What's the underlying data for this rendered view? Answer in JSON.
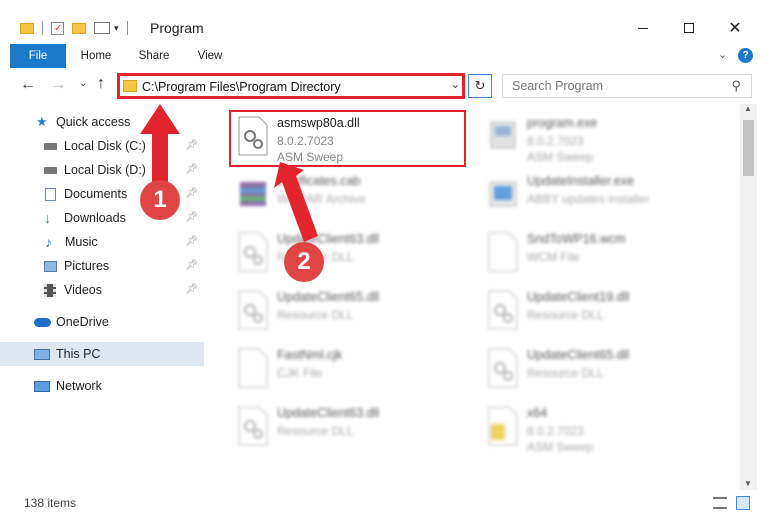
{
  "window": {
    "title": "Program"
  },
  "ribbon": {
    "tabs": [
      "File",
      "Home",
      "Share",
      "View"
    ]
  },
  "address": {
    "path": "C:\\Program Files\\Program Directory"
  },
  "search": {
    "placeholder": "Search Program"
  },
  "sidebar": {
    "items": [
      {
        "label": "Quick access",
        "icon": "star-icon"
      },
      {
        "label": "Local Disk (C:)",
        "icon": "drive-icon"
      },
      {
        "label": "Local Disk (D:)",
        "icon": "drive-icon"
      },
      {
        "label": "Documents",
        "icon": "documents-icon"
      },
      {
        "label": "Downloads",
        "icon": "download-icon"
      },
      {
        "label": "Music",
        "icon": "music-icon"
      },
      {
        "label": "Pictures",
        "icon": "pictures-icon"
      },
      {
        "label": "Videos",
        "icon": "videos-icon"
      },
      {
        "label": "OneDrive",
        "icon": "cloud-icon"
      },
      {
        "label": "This PC",
        "icon": "pc-icon"
      },
      {
        "label": "Network",
        "icon": "network-icon"
      }
    ]
  },
  "files": [
    {
      "name": "asmswp80a.dll",
      "line2": "8.0.2.7023",
      "line3": "ASM Sweep",
      "icon": "dll-gear-icon"
    },
    {
      "name": "program.exe",
      "line2": "8.0.2.7023",
      "line3": "ASM Sweep",
      "icon": "exe-icon"
    },
    {
      "name": "certificates.cab",
      "line2": "WinRAR Archive",
      "line3": "",
      "icon": "archive-icon"
    },
    {
      "name": "UpdateInstaller.exe",
      "line2": "ABBY updates installer",
      "line3": "",
      "icon": "installer-icon"
    },
    {
      "name": "UpdateClient63.dll",
      "line2": "Resource DLL",
      "line3": "",
      "icon": "dll-gear-icon"
    },
    {
      "name": "SndToWP16.wcm",
      "line2": "WCM File",
      "line3": "",
      "icon": "blank-file-icon"
    },
    {
      "name": "UpdateClient65.dll",
      "line2": "Resource DLL",
      "line3": "",
      "icon": "dll-gear-icon"
    },
    {
      "name": "UpdateClient19.dll",
      "line2": "Resource DLL",
      "line3": "",
      "icon": "dll-gear-icon"
    },
    {
      "name": "FastNml.cjk",
      "line2": "CJK File",
      "line3": "",
      "icon": "blank-file-icon"
    },
    {
      "name": "UpdateClient65.dll",
      "line2": "Resource DLL",
      "line3": "",
      "icon": "dll-gear-icon"
    },
    {
      "name": "UpdateClient63.dll",
      "line2": "Resource DLL",
      "line3": "",
      "icon": "dll-gear-icon"
    },
    {
      "name": "x64",
      "line2": "8.0.2.7023",
      "line3": "ASM Sweep",
      "icon": "folder-file-icon"
    }
  ],
  "annotations": {
    "step1": "1",
    "step2": "2",
    "color": "#e2252c"
  },
  "status": {
    "items_count": "138 items"
  }
}
